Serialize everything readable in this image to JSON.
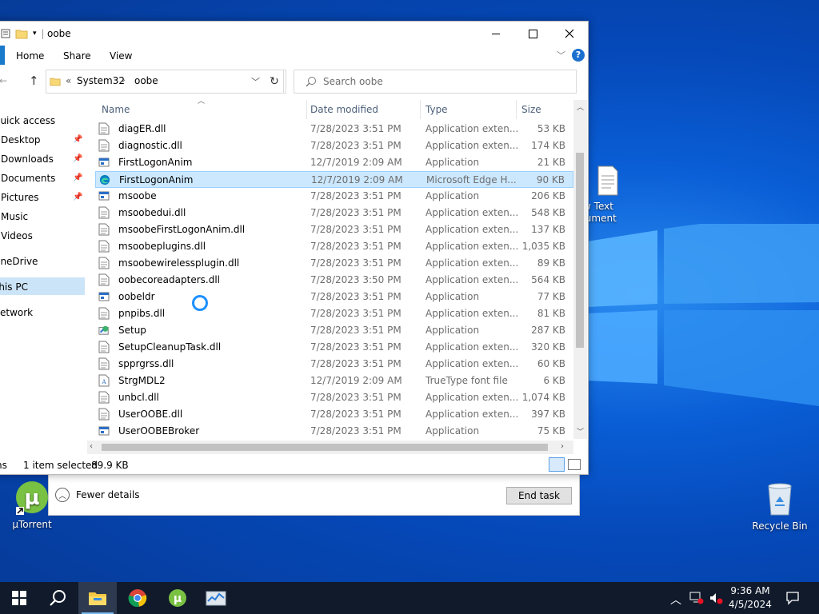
{
  "explorer": {
    "title": "oobe",
    "ribbon_tabs": [
      "Home",
      "Share",
      "View"
    ],
    "address": {
      "parts": [
        "System32",
        "oobe"
      ],
      "prefix": "«"
    },
    "search_placeholder": "Search oobe",
    "nav": [
      {
        "label": "Quick access"
      },
      {
        "label": "Desktop",
        "pinned": true
      },
      {
        "label": "Downloads",
        "pinned": true
      },
      {
        "label": "Documents",
        "pinned": true
      },
      {
        "label": "Pictures",
        "pinned": true
      },
      {
        "label": "Music"
      },
      {
        "label": "Videos"
      },
      {
        "label": "OneDrive"
      },
      {
        "label": "This PC",
        "selected": true
      },
      {
        "label": "Network"
      }
    ],
    "columns": [
      "Name",
      "Date modified",
      "Type",
      "Size"
    ],
    "files": [
      {
        "name": "diagER.dll",
        "date": "7/28/2023 3:51 PM",
        "type": "Application exten...",
        "size": "53 KB",
        "icon": "dll"
      },
      {
        "name": "diagnostic.dll",
        "date": "7/28/2023 3:51 PM",
        "type": "Application exten...",
        "size": "174 KB",
        "icon": "dll"
      },
      {
        "name": "FirstLogonAnim",
        "date": "12/7/2019 2:09 AM",
        "type": "Application",
        "size": "21 KB",
        "icon": "exe"
      },
      {
        "name": "FirstLogonAnim",
        "date": "12/7/2019 2:09 AM",
        "type": "Microsoft Edge H...",
        "size": "90 KB",
        "icon": "edge",
        "selected": true
      },
      {
        "name": "msoobe",
        "date": "7/28/2023 3:51 PM",
        "type": "Application",
        "size": "206 KB",
        "icon": "exe"
      },
      {
        "name": "msoobedui.dll",
        "date": "7/28/2023 3:51 PM",
        "type": "Application exten...",
        "size": "548 KB",
        "icon": "dll"
      },
      {
        "name": "msoobeFirstLogonAnim.dll",
        "date": "7/28/2023 3:51 PM",
        "type": "Application exten...",
        "size": "137 KB",
        "icon": "dll"
      },
      {
        "name": "msoobeplugins.dll",
        "date": "7/28/2023 3:51 PM",
        "type": "Application exten...",
        "size": "1,035 KB",
        "icon": "dll"
      },
      {
        "name": "msoobewirelessplugin.dll",
        "date": "7/28/2023 3:51 PM",
        "type": "Application exten...",
        "size": "89 KB",
        "icon": "dll"
      },
      {
        "name": "oobecoreadapters.dll",
        "date": "7/28/2023 3:50 PM",
        "type": "Application exten...",
        "size": "564 KB",
        "icon": "dll"
      },
      {
        "name": "oobeldr",
        "date": "7/28/2023 3:51 PM",
        "type": "Application",
        "size": "77 KB",
        "icon": "exe"
      },
      {
        "name": "pnpibs.dll",
        "date": "7/28/2023 3:51 PM",
        "type": "Application exten...",
        "size": "81 KB",
        "icon": "dll"
      },
      {
        "name": "Setup",
        "date": "7/28/2023 3:51 PM",
        "type": "Application",
        "size": "287 KB",
        "icon": "setup"
      },
      {
        "name": "SetupCleanupTask.dll",
        "date": "7/28/2023 3:51 PM",
        "type": "Application exten...",
        "size": "320 KB",
        "icon": "dll"
      },
      {
        "name": "spprgrss.dll",
        "date": "7/28/2023 3:51 PM",
        "type": "Application exten...",
        "size": "60 KB",
        "icon": "dll"
      },
      {
        "name": "StrgMDL2",
        "date": "12/7/2019 2:09 AM",
        "type": "TrueType font file",
        "size": "6 KB",
        "icon": "font"
      },
      {
        "name": "unbcl.dll",
        "date": "7/28/2023 3:51 PM",
        "type": "Application exten...",
        "size": "1,074 KB",
        "icon": "dll"
      },
      {
        "name": "UserOOBE.dll",
        "date": "7/28/2023 3:51 PM",
        "type": "Application exten...",
        "size": "397 KB",
        "icon": "dll"
      },
      {
        "name": "UserOOBEBroker",
        "date": "7/28/2023 3:51 PM",
        "type": "Application",
        "size": "75 KB",
        "icon": "exe"
      }
    ],
    "status": {
      "count_fragment": "ns",
      "selected": "1 item selected",
      "size": "89.9 KB"
    }
  },
  "taskmgr": {
    "fewer_details": "Fewer details",
    "end_task": "End task"
  },
  "desktop": {
    "icons": [
      {
        "label_line1": "w Text",
        "label_line2": "cument"
      },
      {
        "label": "µTorrent"
      },
      {
        "label": "Recycle Bin"
      }
    ]
  },
  "taskbar": {
    "time": "9:36 AM",
    "date": "4/5/2024",
    "apps": [
      "start-icon",
      "search-icon",
      "file-explorer-icon",
      "chrome-icon",
      "utorrent-icon",
      "task-manager-icon"
    ]
  }
}
